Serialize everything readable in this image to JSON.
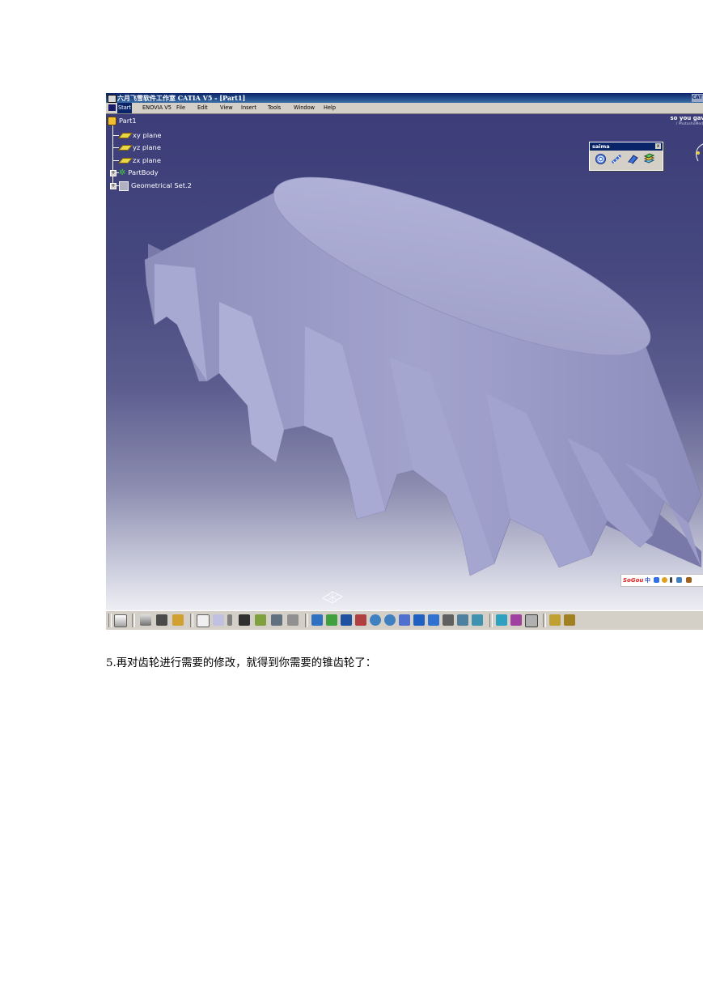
{
  "window": {
    "title": "六月飞雪软件工作室 CATIA V5 - [Part1]",
    "corner_tag": "CAT"
  },
  "menu": {
    "items": [
      "Start",
      "ENOVIA V5",
      "File",
      "Edit",
      "View",
      "Insert",
      "Tools",
      "Window",
      "Help"
    ]
  },
  "tree": {
    "root": "Part1",
    "items": [
      "xy plane",
      "yz plane",
      "zx plane",
      "PartBody",
      "Geometrical Set.2"
    ]
  },
  "overlay": {
    "top_right_text": "so you gav",
    "top_right_sub": "/ PhotoshoMed"
  },
  "floating_toolbar": {
    "title": "saima",
    "close": "x",
    "icons": [
      "spiral-gear-icon",
      "helix-icon",
      "cone-icon",
      "stack-icon"
    ]
  },
  "ime_bar": {
    "logo": "SoGou",
    "mode": "中"
  },
  "caption": "5.再对齿轮进行需要的修改，就得到你需要的锥齿轮了：",
  "colors": {
    "viewport_top": "#3c3d79",
    "viewport_bottom": "#eeeef4",
    "gear_face": "#9b9cc6",
    "gear_top": "#a9aad2",
    "title_bar": "#0a246a",
    "chrome": "#d4d0c8"
  }
}
